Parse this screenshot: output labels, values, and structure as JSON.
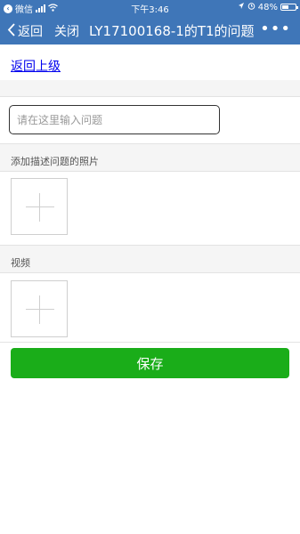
{
  "status_bar": {
    "carrier_label": "微信",
    "time": "下午3:46",
    "battery_percent": "48%",
    "battery_level": 0.48
  },
  "nav": {
    "back_label": "返回",
    "close_label": "关闭",
    "title": "LY17100168-1的T1的问题",
    "more_label": "•••"
  },
  "content": {
    "back_link_label": "返回上级",
    "question_placeholder": "请在这里输入问题",
    "photo_section_label": "添加描述问题的照片",
    "video_section_label": "视频",
    "save_label": "保存"
  },
  "colors": {
    "nav_background": "#3f76b8",
    "save_button": "#1aad19",
    "link": "#0000ee"
  }
}
